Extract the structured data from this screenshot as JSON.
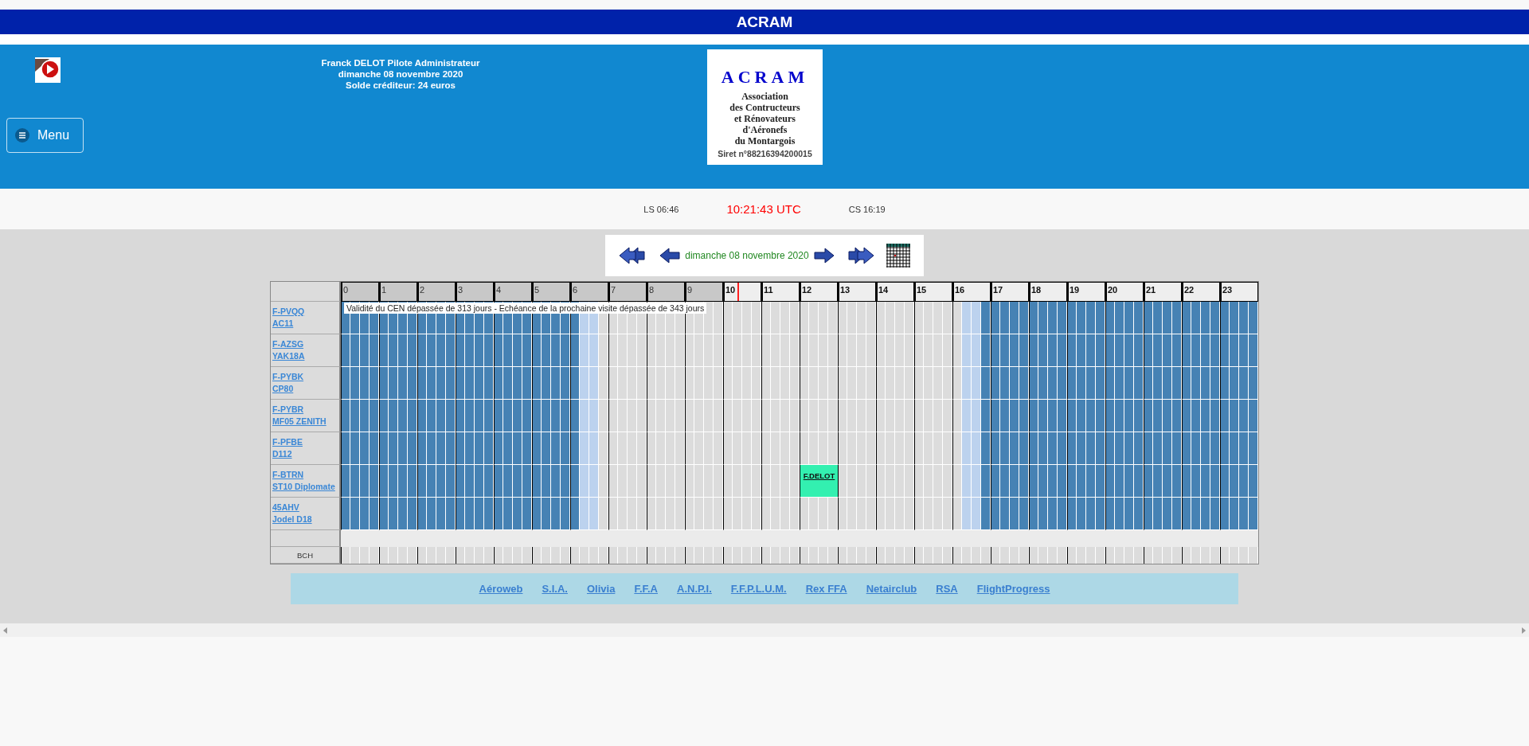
{
  "title_bar": {
    "title": "ACRAM"
  },
  "header": {
    "user_lines": [
      "Franck DELOT Pilote Administrateur",
      "dimanche 08 novembre 2020",
      "Solde créditeur: 24 euros"
    ],
    "menu_label": "Menu",
    "logo": {
      "title": "ACRAM",
      "lines": [
        "Association",
        "des Contructeurs",
        "et Rénovateurs",
        "d'Aéronefs",
        "du Montargois"
      ],
      "siret": "Siret n°88216394200015"
    }
  },
  "sun_bar": {
    "sunrise": "LS 06:46",
    "time": "10:21:43 UTC",
    "sunset": "CS 16:19"
  },
  "date_nav": {
    "date": "dimanche 08 novembre 2020"
  },
  "planning": {
    "hours": [
      {
        "label": "0",
        "past": true,
        "now": false,
        "quarters": [
          {
            "kind": "night"
          },
          {
            "kind": "night"
          },
          {
            "kind": "night"
          },
          {
            "kind": "night"
          }
        ]
      },
      {
        "label": "1",
        "past": true,
        "now": false,
        "quarters": [
          {
            "kind": "night"
          },
          {
            "kind": "night"
          },
          {
            "kind": "night"
          },
          {
            "kind": "night"
          }
        ]
      },
      {
        "label": "2",
        "past": true,
        "now": false,
        "quarters": [
          {
            "kind": "night"
          },
          {
            "kind": "night"
          },
          {
            "kind": "night"
          },
          {
            "kind": "night"
          }
        ]
      },
      {
        "label": "3",
        "past": true,
        "now": false,
        "quarters": [
          {
            "kind": "night"
          },
          {
            "kind": "night"
          },
          {
            "kind": "night"
          },
          {
            "kind": "night"
          }
        ]
      },
      {
        "label": "4",
        "past": true,
        "now": false,
        "quarters": [
          {
            "kind": "night"
          },
          {
            "kind": "night"
          },
          {
            "kind": "night"
          },
          {
            "kind": "night"
          }
        ]
      },
      {
        "label": "5",
        "past": true,
        "now": false,
        "quarters": [
          {
            "kind": "night"
          },
          {
            "kind": "night"
          },
          {
            "kind": "night"
          },
          {
            "kind": "night"
          }
        ]
      },
      {
        "label": "6",
        "past": true,
        "now": false,
        "quarters": [
          {
            "kind": "night"
          },
          {
            "kind": "twilight"
          },
          {
            "kind": "twilight"
          },
          {
            "kind": "day"
          }
        ]
      },
      {
        "label": "7",
        "past": true,
        "now": false,
        "quarters": [
          {
            "kind": "day"
          },
          {
            "kind": "day"
          },
          {
            "kind": "day"
          },
          {
            "kind": "day"
          }
        ]
      },
      {
        "label": "8",
        "past": true,
        "now": false,
        "quarters": [
          {
            "kind": "day"
          },
          {
            "kind": "day"
          },
          {
            "kind": "day"
          },
          {
            "kind": "day"
          }
        ]
      },
      {
        "label": "9",
        "past": true,
        "now": false,
        "quarters": [
          {
            "kind": "day"
          },
          {
            "kind": "day"
          },
          {
            "kind": "day"
          },
          {
            "kind": "day"
          }
        ]
      },
      {
        "label": "10",
        "past": false,
        "now": true,
        "quarters": [
          {
            "kind": "day"
          },
          {
            "kind": "day"
          },
          {
            "kind": "day"
          },
          {
            "kind": "day"
          }
        ]
      },
      {
        "label": "11",
        "past": false,
        "now": false,
        "quarters": [
          {
            "kind": "day"
          },
          {
            "kind": "day"
          },
          {
            "kind": "day"
          },
          {
            "kind": "day"
          }
        ]
      },
      {
        "label": "12",
        "past": false,
        "now": false,
        "quarters": [
          {
            "kind": "day"
          },
          {
            "kind": "day"
          },
          {
            "kind": "day"
          },
          {
            "kind": "day"
          }
        ]
      },
      {
        "label": "13",
        "past": false,
        "now": false,
        "quarters": [
          {
            "kind": "day"
          },
          {
            "kind": "day"
          },
          {
            "kind": "day"
          },
          {
            "kind": "day"
          }
        ]
      },
      {
        "label": "14",
        "past": false,
        "now": false,
        "quarters": [
          {
            "kind": "day"
          },
          {
            "kind": "day"
          },
          {
            "kind": "day"
          },
          {
            "kind": "day"
          }
        ]
      },
      {
        "label": "15",
        "past": false,
        "now": false,
        "quarters": [
          {
            "kind": "day"
          },
          {
            "kind": "day"
          },
          {
            "kind": "day"
          },
          {
            "kind": "day"
          }
        ]
      },
      {
        "label": "16",
        "past": false,
        "now": false,
        "quarters": [
          {
            "kind": "day"
          },
          {
            "kind": "twilight"
          },
          {
            "kind": "twilight"
          },
          {
            "kind": "night"
          }
        ]
      },
      {
        "label": "17",
        "past": false,
        "now": false,
        "quarters": [
          {
            "kind": "night"
          },
          {
            "kind": "night"
          },
          {
            "kind": "night"
          },
          {
            "kind": "night"
          }
        ]
      },
      {
        "label": "18",
        "past": false,
        "now": false,
        "quarters": [
          {
            "kind": "night"
          },
          {
            "kind": "night"
          },
          {
            "kind": "night"
          },
          {
            "kind": "night"
          }
        ]
      },
      {
        "label": "19",
        "past": false,
        "now": false,
        "quarters": [
          {
            "kind": "night"
          },
          {
            "kind": "night"
          },
          {
            "kind": "night"
          },
          {
            "kind": "night"
          }
        ]
      },
      {
        "label": "20",
        "past": false,
        "now": false,
        "quarters": [
          {
            "kind": "night"
          },
          {
            "kind": "night"
          },
          {
            "kind": "night"
          },
          {
            "kind": "night"
          }
        ]
      },
      {
        "label": "21",
        "past": false,
        "now": false,
        "quarters": [
          {
            "kind": "night"
          },
          {
            "kind": "night"
          },
          {
            "kind": "night"
          },
          {
            "kind": "night"
          }
        ]
      },
      {
        "label": "22",
        "past": false,
        "now": false,
        "quarters": [
          {
            "kind": "night"
          },
          {
            "kind": "night"
          },
          {
            "kind": "night"
          },
          {
            "kind": "night"
          }
        ]
      },
      {
        "label": "23",
        "past": false,
        "now": false,
        "quarters": [
          {
            "kind": "night"
          },
          {
            "kind": "night"
          },
          {
            "kind": "night"
          },
          {
            "kind": "night"
          }
        ]
      }
    ],
    "aircraft": [
      {
        "registration": "F-PVQQ",
        "model": "AC11",
        "warning": "Validité du CEN dépassée de 313 jours - Echéance de la prochaine visite dépassée de 343 jours",
        "hours": [
          {
            "booked": false
          },
          {
            "booked": false
          },
          {
            "booked": false
          },
          {
            "booked": false
          },
          {
            "booked": false
          },
          {
            "booked": false
          },
          {
            "booked": false
          },
          {
            "booked": false
          },
          {
            "booked": false
          },
          {
            "booked": false
          },
          {
            "booked": false
          },
          {
            "booked": false
          },
          {
            "booked": false
          },
          {
            "booked": false
          },
          {
            "booked": false
          },
          {
            "booked": false
          },
          {
            "booked": false
          },
          {
            "booked": false
          },
          {
            "booked": false
          },
          {
            "booked": false
          },
          {
            "booked": false
          },
          {
            "booked": false
          },
          {
            "booked": false
          },
          {
            "booked": false
          }
        ]
      },
      {
        "registration": "F-AZSG",
        "model": "YAK18A",
        "hours": [
          {
            "booked": false
          },
          {
            "booked": false
          },
          {
            "booked": false
          },
          {
            "booked": false
          },
          {
            "booked": false
          },
          {
            "booked": false
          },
          {
            "booked": false
          },
          {
            "booked": false
          },
          {
            "booked": false
          },
          {
            "booked": false
          },
          {
            "booked": false
          },
          {
            "booked": false
          },
          {
            "booked": false
          },
          {
            "booked": false
          },
          {
            "booked": false
          },
          {
            "booked": false
          },
          {
            "booked": false
          },
          {
            "booked": false
          },
          {
            "booked": false
          },
          {
            "booked": false
          },
          {
            "booked": false
          },
          {
            "booked": false
          },
          {
            "booked": false
          },
          {
            "booked": false
          }
        ]
      },
      {
        "registration": "F-PYBK",
        "model": "CP80",
        "hours": [
          {
            "booked": false
          },
          {
            "booked": false
          },
          {
            "booked": false
          },
          {
            "booked": false
          },
          {
            "booked": false
          },
          {
            "booked": false
          },
          {
            "booked": false
          },
          {
            "booked": false
          },
          {
            "booked": false
          },
          {
            "booked": false
          },
          {
            "booked": false
          },
          {
            "booked": false
          },
          {
            "booked": false
          },
          {
            "booked": false
          },
          {
            "booked": false
          },
          {
            "booked": false
          },
          {
            "booked": false
          },
          {
            "booked": false
          },
          {
            "booked": false
          },
          {
            "booked": false
          },
          {
            "booked": false
          },
          {
            "booked": false
          },
          {
            "booked": false
          },
          {
            "booked": false
          }
        ]
      },
      {
        "registration": "F-PYBR",
        "model": "MF05 ZENITH",
        "hours": [
          {
            "booked": false
          },
          {
            "booked": false
          },
          {
            "booked": false
          },
          {
            "booked": false
          },
          {
            "booked": false
          },
          {
            "booked": false
          },
          {
            "booked": false
          },
          {
            "booked": false
          },
          {
            "booked": false
          },
          {
            "booked": false
          },
          {
            "booked": false
          },
          {
            "booked": false
          },
          {
            "booked": false
          },
          {
            "booked": false
          },
          {
            "booked": false
          },
          {
            "booked": false
          },
          {
            "booked": false
          },
          {
            "booked": false
          },
          {
            "booked": false
          },
          {
            "booked": false
          },
          {
            "booked": false
          },
          {
            "booked": false
          },
          {
            "booked": false
          },
          {
            "booked": false
          }
        ]
      },
      {
        "registration": "F-PFBE",
        "model": "D112",
        "hours": [
          {
            "booked": false
          },
          {
            "booked": false
          },
          {
            "booked": false
          },
          {
            "booked": false
          },
          {
            "booked": false
          },
          {
            "booked": false
          },
          {
            "booked": false
          },
          {
            "booked": false
          },
          {
            "booked": false
          },
          {
            "booked": false
          },
          {
            "booked": false
          },
          {
            "booked": false
          },
          {
            "booked": false
          },
          {
            "booked": false
          },
          {
            "booked": false
          },
          {
            "booked": false
          },
          {
            "booked": false
          },
          {
            "booked": false
          },
          {
            "booked": false
          },
          {
            "booked": false
          },
          {
            "booked": false
          },
          {
            "booked": false
          },
          {
            "booked": false
          },
          {
            "booked": false
          }
        ]
      },
      {
        "registration": "F-BTRN",
        "model": "ST10 Diplomate",
        "hours": [
          {
            "booked": false
          },
          {
            "booked": false
          },
          {
            "booked": false
          },
          {
            "booked": false
          },
          {
            "booked": false
          },
          {
            "booked": false
          },
          {
            "booked": false
          },
          {
            "booked": false
          },
          {
            "booked": false
          },
          {
            "booked": false
          },
          {
            "booked": false
          },
          {
            "booked": false
          },
          {
            "booked": true,
            "pilot": "F.DELOT"
          },
          {
            "booked": false
          },
          {
            "booked": false
          },
          {
            "booked": false
          },
          {
            "booked": false
          },
          {
            "booked": false
          },
          {
            "booked": false
          },
          {
            "booked": false
          },
          {
            "booked": false
          },
          {
            "booked": false
          },
          {
            "booked": false
          },
          {
            "booked": false
          }
        ]
      },
      {
        "registration": "45AHV",
        "model": "Jodel D18",
        "hours": [
          {
            "booked": false
          },
          {
            "booked": false
          },
          {
            "booked": false
          },
          {
            "booked": false
          },
          {
            "booked": false
          },
          {
            "booked": false
          },
          {
            "booked": false
          },
          {
            "booked": false
          },
          {
            "booked": false
          },
          {
            "booked": false
          },
          {
            "booked": false
          },
          {
            "booked": false
          },
          {
            "booked": false
          },
          {
            "booked": false
          },
          {
            "booked": false
          },
          {
            "booked": false
          },
          {
            "booked": false
          },
          {
            "booked": false
          },
          {
            "booked": false
          },
          {
            "booked": false
          },
          {
            "booked": false
          },
          {
            "booked": false
          },
          {
            "booked": false
          },
          {
            "booked": false
          }
        ]
      }
    ],
    "bch_label": "BCH"
  },
  "links": [
    "Aéroweb",
    "S.I.A.",
    "Olivia",
    "F.F.A",
    "A.N.P.I.",
    "F.F.P.L.U.M.",
    "Rex FFA",
    "Netairclub",
    "RSA",
    "FlightProgress"
  ]
}
